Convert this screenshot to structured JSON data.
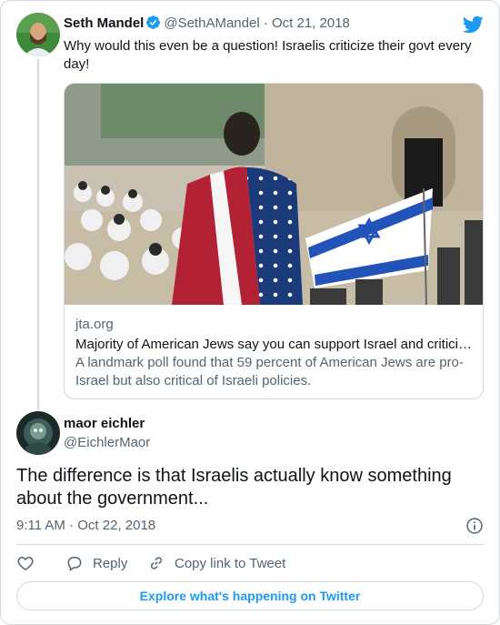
{
  "colors": {
    "accent": "#1d9bf0",
    "text": "#0f1419",
    "muted": "#536471",
    "border": "#cfd9de"
  },
  "tweet1": {
    "author_name": "Seth Mandel",
    "handle": "@SethAMandel",
    "separator": "·",
    "date": "Oct 21, 2018",
    "text": "Why would this even be a question! Israelis criticize their govt every day!",
    "card": {
      "domain": "jta.org",
      "title": "Majority of American Jews say you can support Israel and criticize its policies",
      "description": "A landmark poll found that 59 percent of American Jews are pro-Israel but also critical of Israeli policies."
    }
  },
  "tweet2": {
    "author_name": "maor eichler",
    "handle": "@EichlerMaor",
    "text": "The difference is that Israelis actually know something about the government...",
    "time": "9:11 AM · Oct 22, 2018",
    "actions": {
      "reply_label": "Reply",
      "copy_label": "Copy link to Tweet"
    }
  },
  "explore_label": "Explore what's happening on Twitter",
  "icons": [
    "twitter-bird-icon",
    "verified-badge-icon",
    "info-icon",
    "heart-icon",
    "reply-icon",
    "link-icon"
  ]
}
